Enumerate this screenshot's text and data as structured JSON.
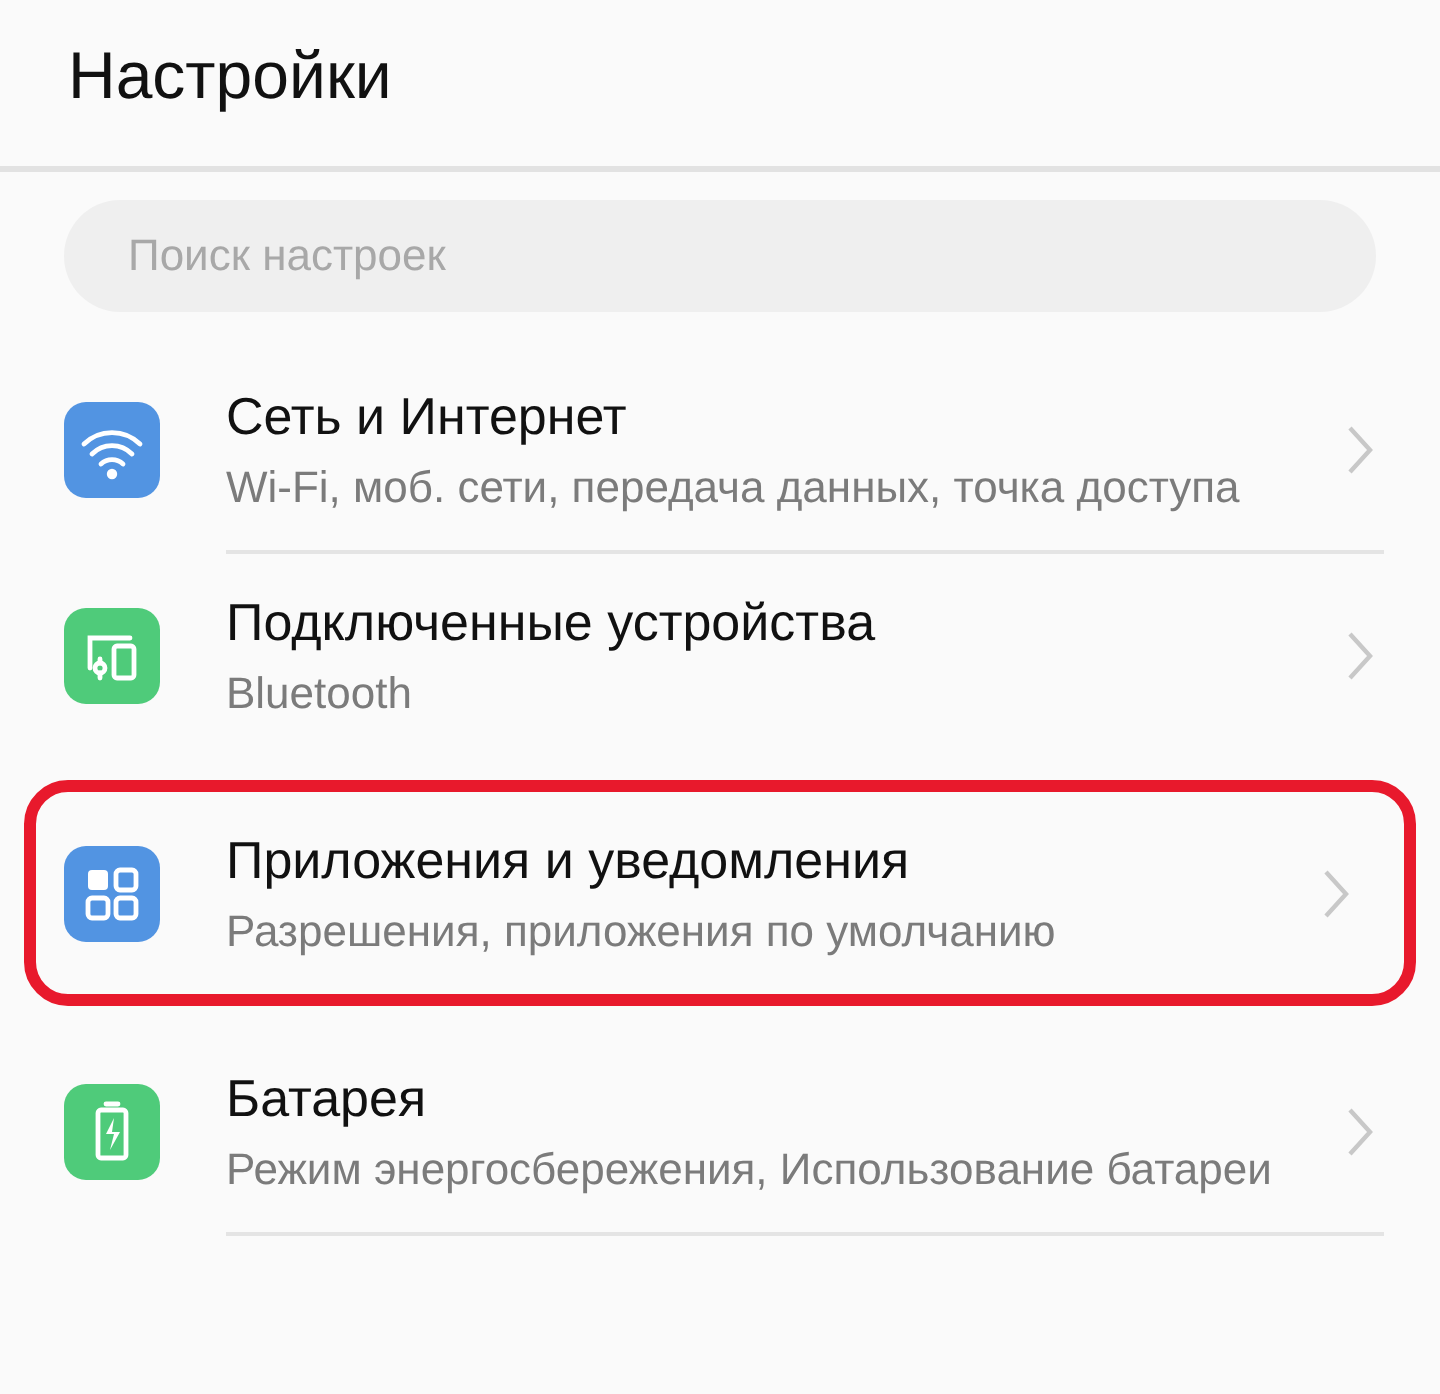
{
  "header": {
    "title": "Настройки"
  },
  "search": {
    "placeholder": "Поиск настроек"
  },
  "items": [
    {
      "kind": "wifi",
      "color": "#5294e2",
      "title": "Сеть и Интернет",
      "subtitle": "Wi-Fi, моб. сети, передача данных, точка доступа",
      "highlighted": false
    },
    {
      "kind": "devices",
      "color": "#4fcb7a",
      "title": "Подключенные устройства",
      "subtitle": "Bluetooth",
      "highlighted": false
    },
    {
      "kind": "apps",
      "color": "#5294e2",
      "title": "Приложения и уведомления",
      "subtitle": "Разрешения, приложения по умолчанию",
      "highlighted": true
    },
    {
      "kind": "battery",
      "color": "#4fcb7a",
      "title": "Батарея",
      "subtitle": "Режим энергосбережения, Использование батареи",
      "highlighted": false
    }
  ]
}
